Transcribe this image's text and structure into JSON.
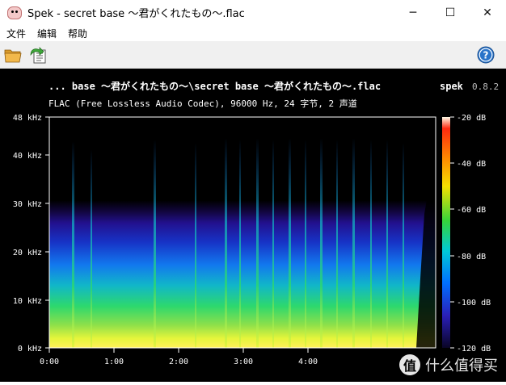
{
  "window": {
    "title": "Spek - secret base ～君がくれたもの～.flac",
    "minimize": "─",
    "maximize": "☐",
    "close": "✕"
  },
  "menu": {
    "items": [
      "文件",
      "编辑",
      "帮助"
    ]
  },
  "toolbar": {
    "open_icon": "folder-open-icon",
    "save_icon": "save-image-icon",
    "help_icon": "help-icon"
  },
  "spectrogram": {
    "file_label": "... base ～君がくれたもの～\\secret base ～君がくれたもの～.flac",
    "app_label": "spek",
    "version": "0.8.2",
    "format_info": "FLAC (Free Lossless Audio Codec), 96000 Hz, 24 字节, 2 声道",
    "y_ticks": [
      "48 kHz",
      "40 kHz",
      "30 kHz",
      "20 kHz",
      "10 kHz",
      "0 kHz"
    ],
    "x_ticks": [
      "0:00",
      "1:00",
      "2:00",
      "3:00",
      "4:00"
    ],
    "db_ticks": [
      "-20 dB",
      "-40 dB",
      "-60 dB",
      "-80 dB",
      "-100 dB",
      "-120 dB"
    ]
  },
  "watermark": {
    "badge": "值",
    "text": "什么值得买"
  },
  "colors": {
    "background": "#000000",
    "label": "#ffffff",
    "version": "#bdbdbd"
  }
}
